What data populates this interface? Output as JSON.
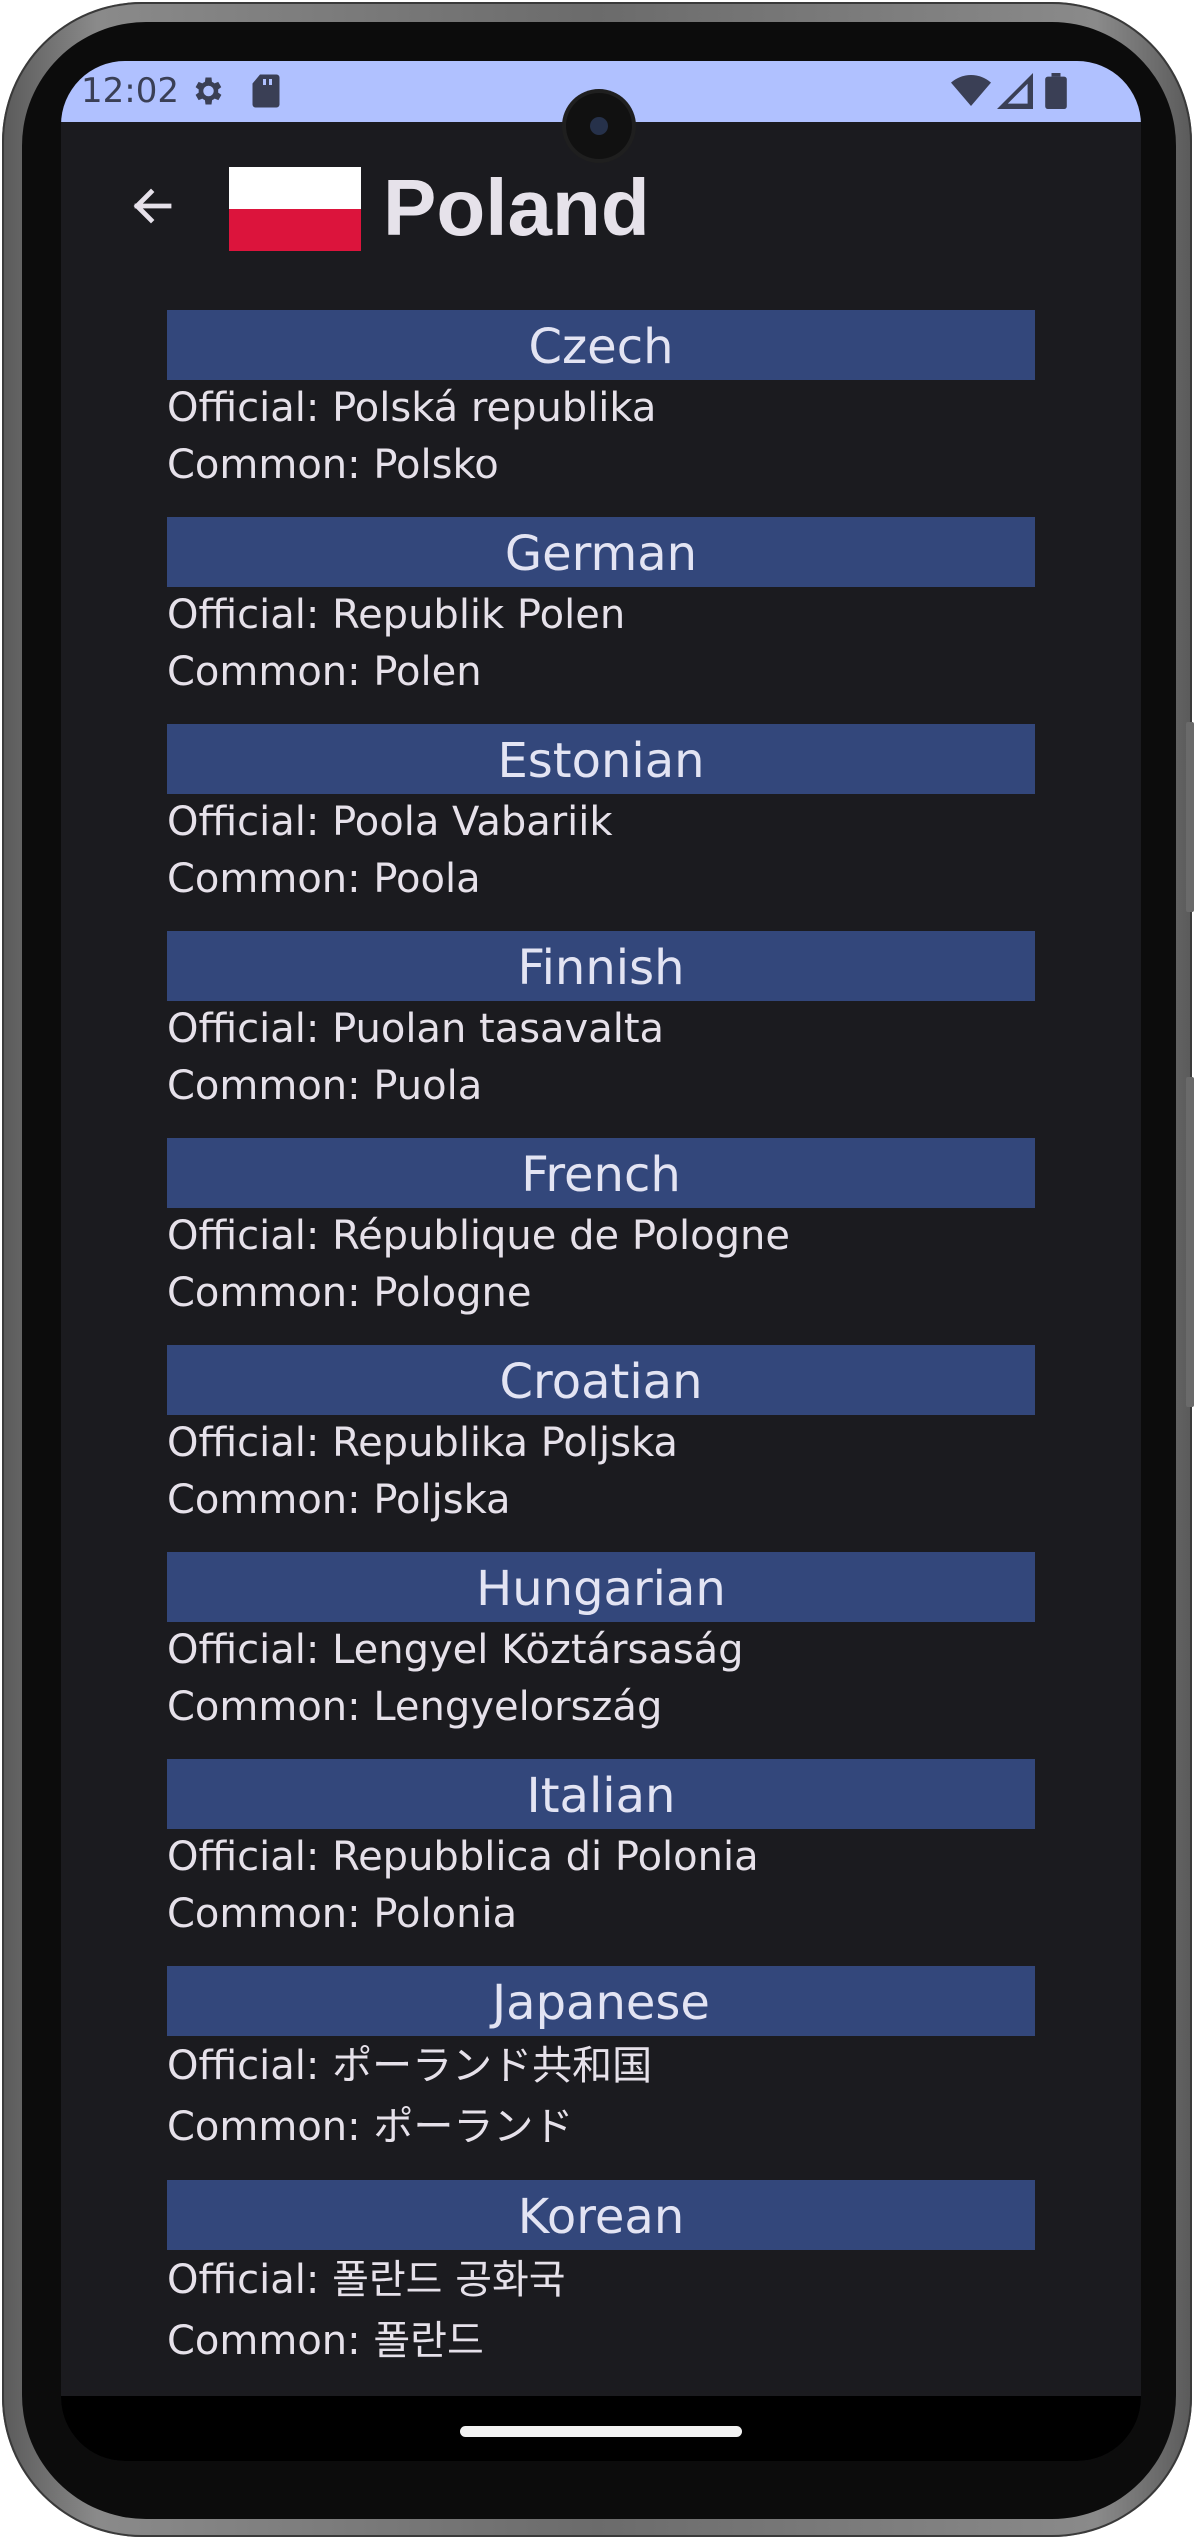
{
  "status_bar": {
    "time": "12:02",
    "left_icons": [
      "gear-icon",
      "sd-card-icon"
    ],
    "right_icons": [
      "wifi-icon",
      "signal-icon",
      "battery-icon"
    ],
    "color": "#b0c1ff"
  },
  "app_bar": {
    "back_icon": "arrow-left-icon",
    "flag": "poland-flag",
    "title": "Poland"
  },
  "translations": [
    {
      "language": "Czech",
      "official": "Official: Polská republika",
      "common": "Common: Polsko"
    },
    {
      "language": "German",
      "official": "Official: Republik Polen",
      "common": "Common: Polen"
    },
    {
      "language": "Estonian",
      "official": "Official: Poola Vabariik",
      "common": "Common: Poola"
    },
    {
      "language": "Finnish",
      "official": "Official: Puolan tasavalta",
      "common": "Common: Puola"
    },
    {
      "language": "French",
      "official": "Official: République de Pologne",
      "common": "Common: Pologne"
    },
    {
      "language": "Croatian",
      "official": "Official: Republika Poljska",
      "common": "Common: Poljska"
    },
    {
      "language": "Hungarian",
      "official": "Official: Lengyel Köztársaság",
      "common": "Common: Lengyelország"
    },
    {
      "language": "Italian",
      "official": "Official: Repubblica di Polonia",
      "common": "Common: Polonia"
    },
    {
      "language": "Japanese",
      "official": "Official: ポーランド共和国",
      "common": "Common: ポーランド"
    },
    {
      "language": "Korean",
      "official": "Official: 폴란드 공화국",
      "common": "Common: 폴란드"
    }
  ],
  "colors": {
    "background": "#1b1b1f",
    "header_band": "#33477b",
    "text": "#e6e1ea"
  }
}
